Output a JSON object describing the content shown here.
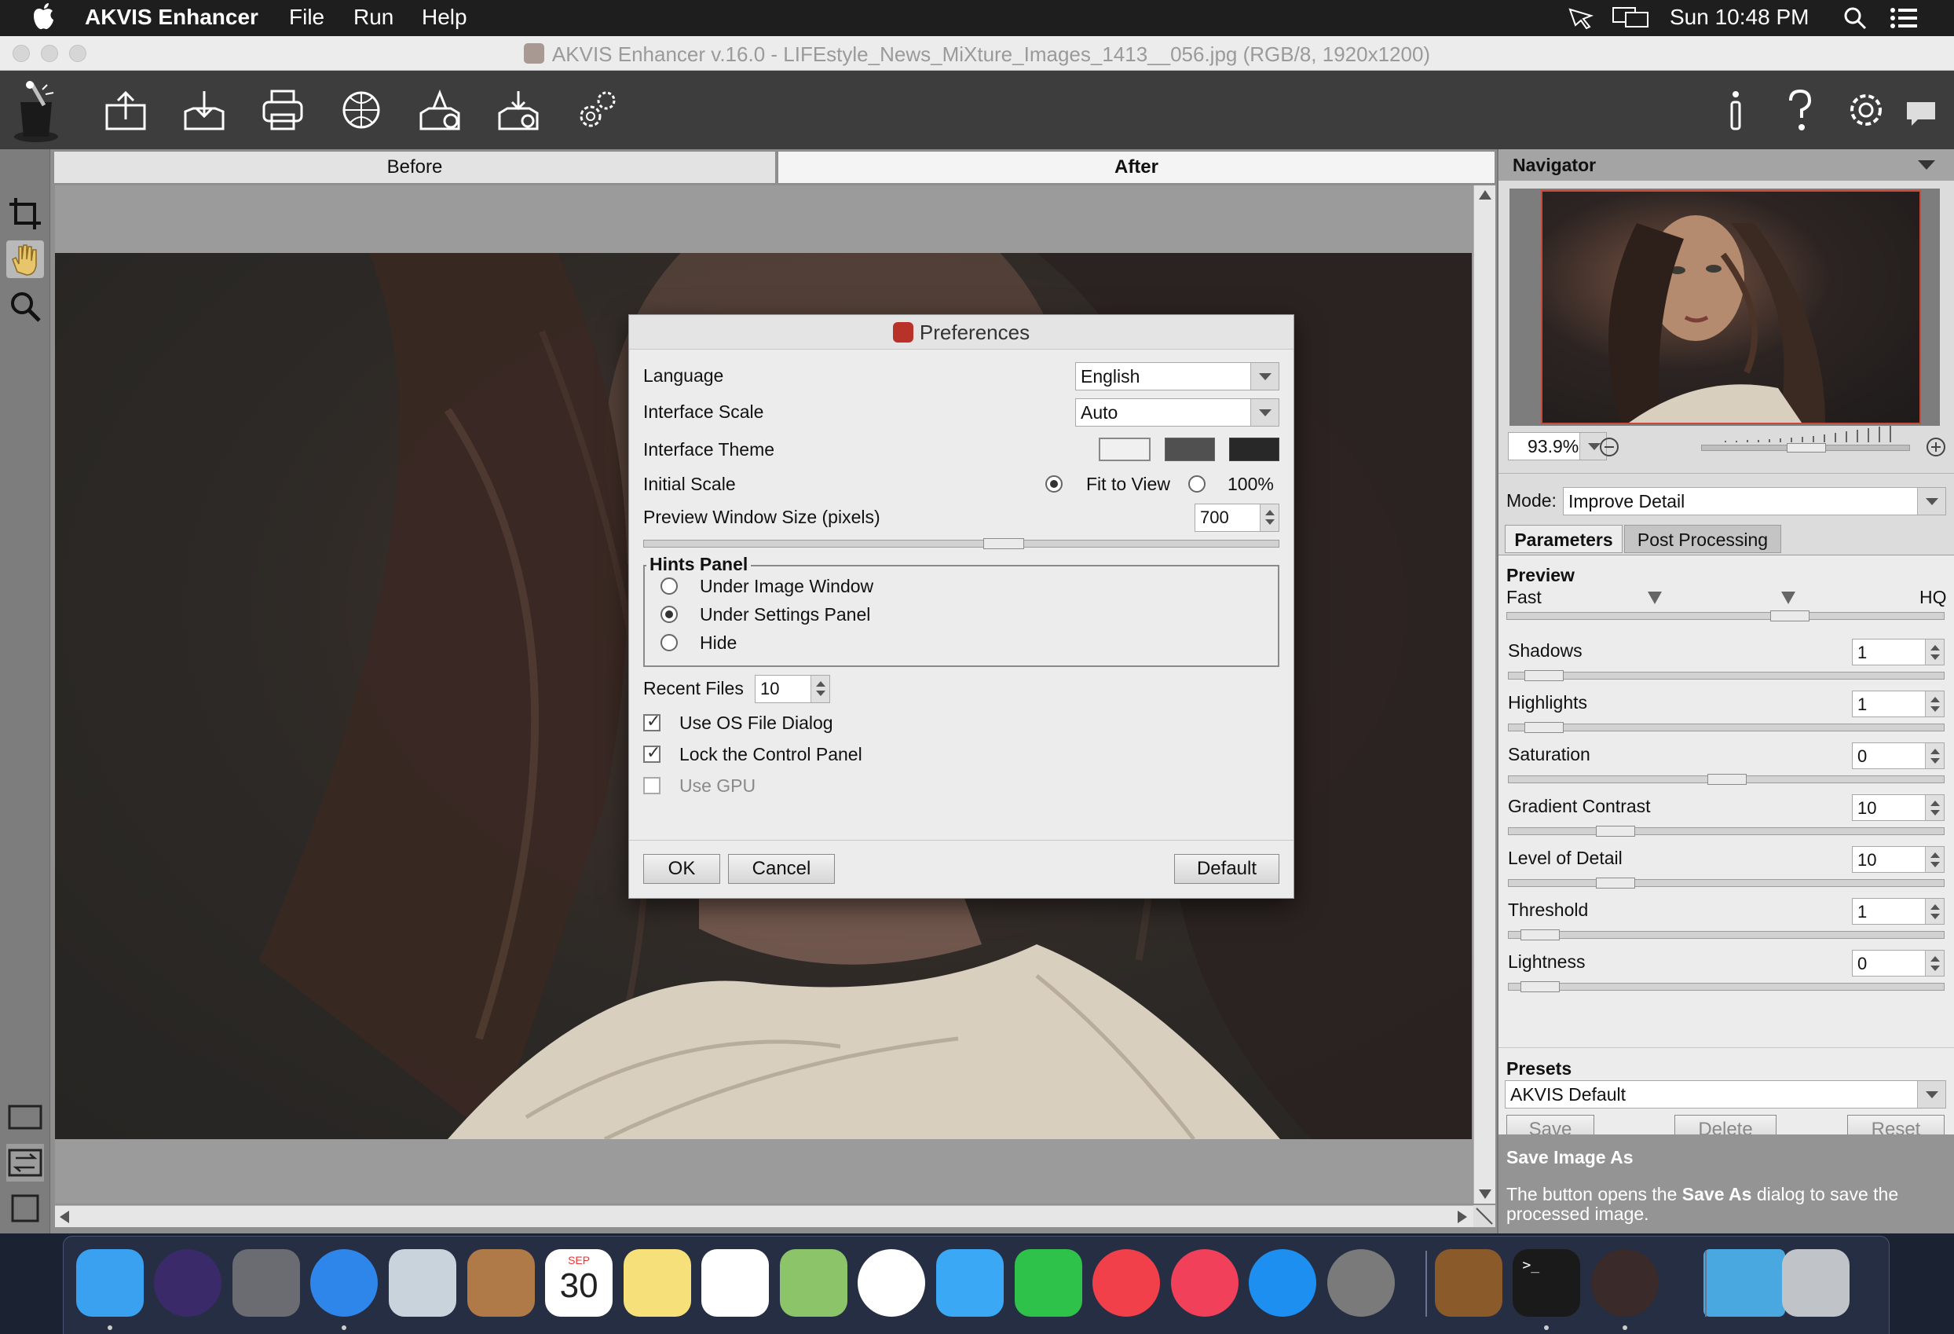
{
  "menubar": {
    "app_name": "AKVIS Enhancer",
    "menus": [
      "File",
      "Run",
      "Help"
    ],
    "clock": "Sun 10:48 PM"
  },
  "window": {
    "title": "AKVIS Enhancer v.16.0 - LIFEstyle_News_MiXture_Images_1413__056.jpg (RGB/8, 1920x1200)"
  },
  "toolbar": {
    "icons": [
      "akvis-logo-icon",
      "open-icon",
      "save-icon",
      "print-icon",
      "share-icon",
      "batch-icon",
      "plugins-icon",
      "settings-gear-icon",
      "info-icon",
      "help-icon",
      "preferences-icon",
      "hints-icon"
    ]
  },
  "left_tools": [
    "crop-icon",
    "hand-icon",
    "zoom-icon",
    "view-single-icon",
    "view-swap-icon",
    "view-split-icon"
  ],
  "view_tabs": {
    "before": "Before",
    "after": "After"
  },
  "dialog": {
    "title": "Preferences",
    "language_label": "Language",
    "language_value": "English",
    "scale_label": "Interface Scale",
    "scale_value": "Auto",
    "theme_label": "Interface Theme",
    "themes": [
      "#f0f0f0",
      "#505050",
      "#282828"
    ],
    "initial_scale_label": "Initial Scale",
    "fit_label": "Fit to View",
    "pct_label": "100%",
    "preview_size_label": "Preview Window Size (pixels)",
    "preview_size_value": "700",
    "hints_title": "Hints Panel",
    "hints_options": [
      "Under Image Window",
      "Under Settings Panel",
      "Hide"
    ],
    "hints_selected": 1,
    "recent_label": "Recent Files",
    "recent_value": "10",
    "use_os_dialog": "Use OS File Dialog",
    "lock_panel": "Lock the Control Panel",
    "use_gpu": "Use GPU",
    "ok": "OK",
    "cancel": "Cancel",
    "default": "Default"
  },
  "navigator": {
    "title": "Navigator",
    "zoom": "93.9%"
  },
  "mode": {
    "label": "Mode:",
    "value": "Improve Detail"
  },
  "param_tabs": {
    "parameters": "Parameters",
    "post": "Post Processing"
  },
  "preview": {
    "title": "Preview",
    "fast": "Fast",
    "hq": "HQ",
    "level": 0.66
  },
  "params": [
    {
      "name": "Shadows",
      "value": "1",
      "pos": 0.04
    },
    {
      "name": "Highlights",
      "value": "1",
      "pos": 0.04
    },
    {
      "name": "Saturation",
      "value": "0",
      "pos": 0.5
    },
    {
      "name": "Gradient Contrast",
      "value": "10",
      "pos": 0.22
    },
    {
      "name": "Level of Detail",
      "value": "10",
      "pos": 0.22
    },
    {
      "name": "Threshold",
      "value": "1",
      "pos": 0.03
    },
    {
      "name": "Lightness",
      "value": "0",
      "pos": 0.03
    }
  ],
  "presets": {
    "title": "Presets",
    "value": "AKVIS Default",
    "save": "Save",
    "delete": "Delete",
    "reset": "Reset"
  },
  "hint": {
    "title": "Save Image As",
    "text_before": "The button opens the ",
    "text_bold": "Save As",
    "text_after": " dialog to save the processed image."
  },
  "dock": {
    "apps": [
      "finder",
      "siri",
      "launchpad",
      "safari",
      "mail",
      "contacts",
      "calendar",
      "notes",
      "reminders",
      "maps",
      "photos",
      "messages",
      "facetime",
      "news",
      "music",
      "app-store",
      "system-preferences",
      "books-stack",
      "terminal",
      "akvis",
      "downloads",
      "trash"
    ],
    "calendar_month": "SEP",
    "calendar_day": "30"
  }
}
